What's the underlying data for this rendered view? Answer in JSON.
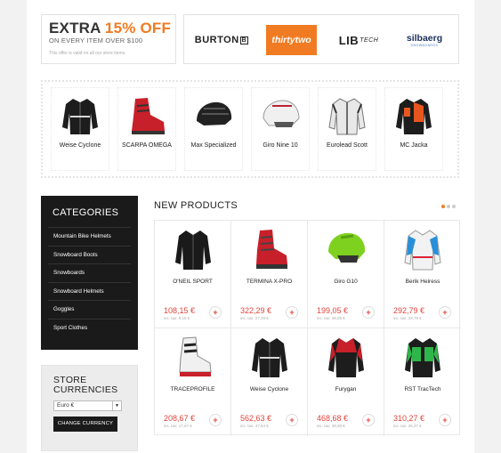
{
  "promo": {
    "headline_1": "EXTRA ",
    "headline_pct": "15% OFF",
    "subline": "ON EVERY ITEM OVER $100",
    "note": "This offer is valid on all our store items."
  },
  "brands": {
    "burton": "BURTON",
    "burton_box": "B",
    "thirtytwo": "thirtytwo",
    "lib": "LIB",
    "lib_tech": "TECH",
    "silbaerg": "silbaerg",
    "silbaerg_tag": "SNOWBOARDS"
  },
  "featured": [
    {
      "name": "Weise Cyclone",
      "icon": "black-jacket-icon"
    },
    {
      "name": "SCARPA OMEGA",
      "icon": "red-boot-icon"
    },
    {
      "name": "Max Specialized",
      "icon": "black-helmet-icon"
    },
    {
      "name": "Giro Nine 10",
      "icon": "white-helmet-icon"
    },
    {
      "name": "Eurolead Scott",
      "icon": "white-jacket-icon"
    },
    {
      "name": "MC Jacka",
      "icon": "orange-jacket-icon"
    }
  ],
  "categories": {
    "title": "CATEGORIES",
    "items": [
      "Mountain Bike Helmets",
      "Snowboard Boots",
      "Snowboards",
      "Snowboard Helmets",
      "Goggles",
      "Sport Clothes"
    ]
  },
  "currencies": {
    "title_1": "STORE",
    "title_2": "CURRENCIES",
    "selected": "Euro €",
    "button": "CHANGE CURRENCY"
  },
  "new_products": {
    "title": "NEW PRODUCTS",
    "items": [
      {
        "name": "O'NEIL SPORT",
        "price": "108,15 €",
        "tax": "inc. tax: 8,15 €",
        "icon": "black-jacket-icon"
      },
      {
        "name": "TERMINA X-PRO",
        "price": "322,29 €",
        "tax": "inc. tax: 27,29 €",
        "icon": "red-boot-icon"
      },
      {
        "name": "Giro G10",
        "price": "199,05 €",
        "tax": "inc. tax: 49,05 €",
        "icon": "green-helmet-icon"
      },
      {
        "name": "Berik Heiress",
        "price": "292,79 €",
        "tax": "inc. tax: 24,79 €",
        "icon": "blue-jacket-icon"
      },
      {
        "name": "TRACEPROFILE",
        "price": "208,67 €",
        "tax": "inc. tax: 17,67 €",
        "icon": "white-boot-icon"
      },
      {
        "name": "Weise Cyclone",
        "price": "562,63 €",
        "tax": "inc. tax: 47,64 €",
        "icon": "black-jacket-icon"
      },
      {
        "name": "Furygan",
        "price": "468,68 €",
        "tax": "inc. tax: 39,68 €",
        "icon": "red-jacket-icon"
      },
      {
        "name": "RST TracTech",
        "price": "310,27 €",
        "tax": "inc. tax: 26,27 €",
        "icon": "green-jacket-icon"
      }
    ],
    "add_symbol": "+"
  },
  "colors": {
    "accent": "#f07b22",
    "price": "#e0443c",
    "dark": "#1a1a1a"
  }
}
